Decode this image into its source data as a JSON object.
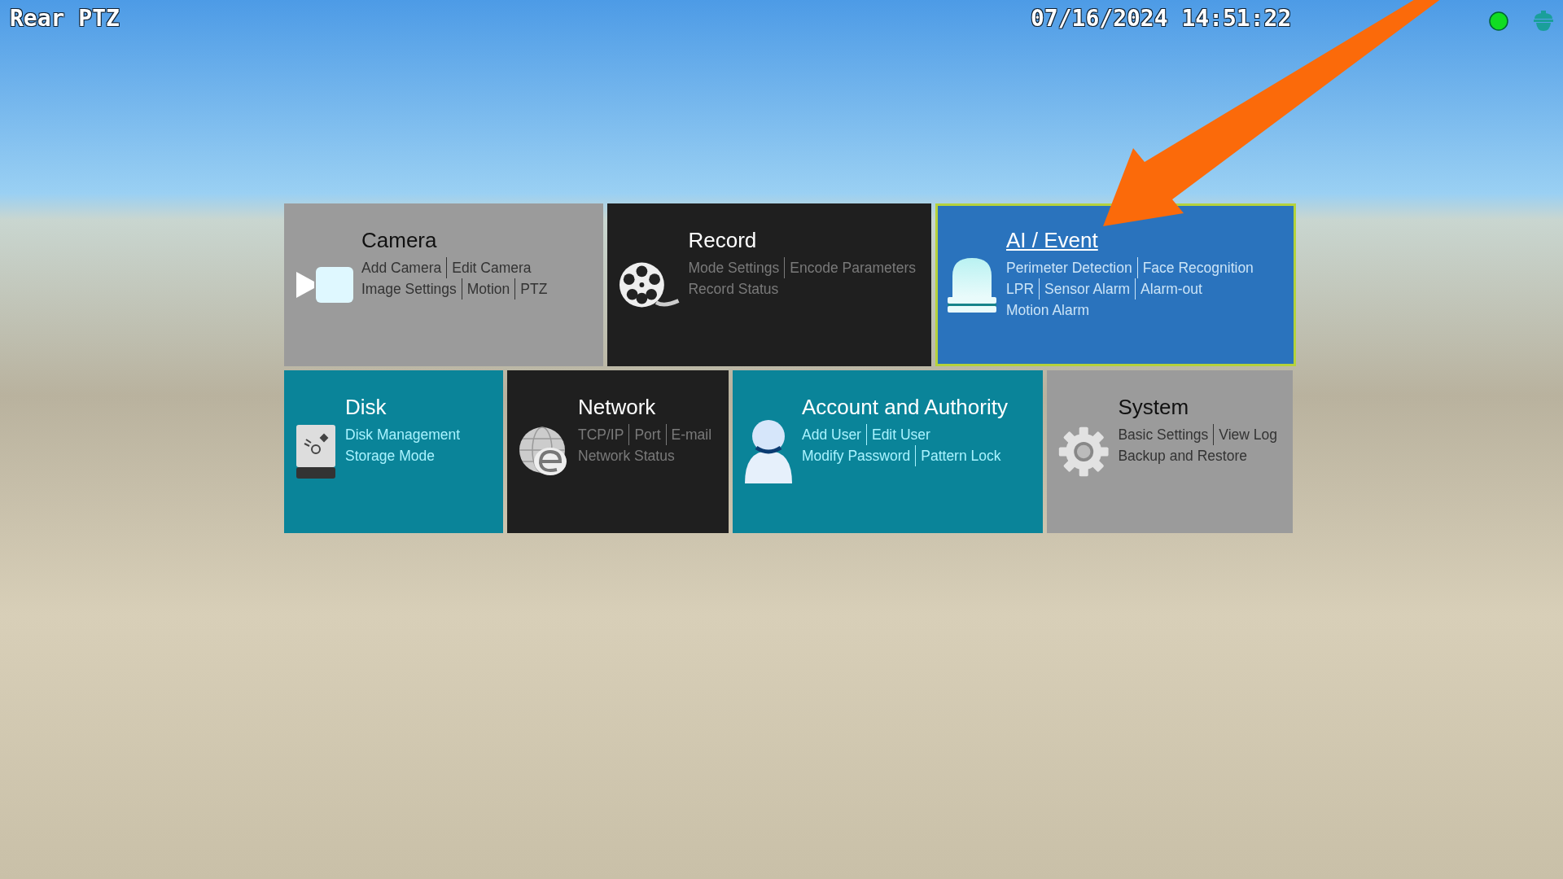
{
  "overlay": {
    "camera_name": "Rear PTZ",
    "datetime": "07/16/2024 14:51:22"
  },
  "menu": {
    "tiles": [
      {
        "kind": "camera",
        "title": "Camera",
        "color": "#9b9b9b",
        "selected": false,
        "lines": [
          [
            "Add Camera",
            "Edit Camera"
          ],
          [
            "Image Settings",
            "Motion",
            "PTZ"
          ]
        ]
      },
      {
        "kind": "record",
        "title": "Record",
        "color": "#1f1f1f",
        "selected": false,
        "lines": [
          [
            "Mode Settings",
            "Encode Parameters"
          ],
          [
            "Record Status"
          ]
        ]
      },
      {
        "kind": "alarm",
        "title": "AI / Event",
        "color": "#2a73bd",
        "selected": true,
        "lines": [
          [
            "Perimeter Detection",
            "Face Recognition"
          ],
          [
            "LPR",
            "Sensor Alarm",
            "Alarm-out"
          ],
          [
            "Motion Alarm"
          ]
        ]
      },
      {
        "kind": "disk",
        "title": "Disk",
        "color": "#0a8499",
        "selected": false,
        "lines": [
          [
            "Disk Management"
          ],
          [
            "Storage Mode"
          ]
        ]
      },
      {
        "kind": "network",
        "title": "Network",
        "color": "#1f1f1f",
        "selected": false,
        "lines": [
          [
            "TCP/IP",
            "Port",
            "E-mail"
          ],
          [
            "Network Status"
          ]
        ]
      },
      {
        "kind": "account",
        "title": "Account and Authority",
        "color": "#0a8499",
        "selected": false,
        "lines": [
          [
            "Add User",
            "Edit User"
          ],
          [
            "Modify Password",
            "Pattern Lock"
          ]
        ]
      },
      {
        "kind": "system",
        "title": "System",
        "color": "#9b9b9b",
        "selected": false,
        "lines": [
          [
            "Basic Settings",
            "View Log"
          ],
          [
            "Backup and Restore"
          ]
        ]
      }
    ]
  }
}
